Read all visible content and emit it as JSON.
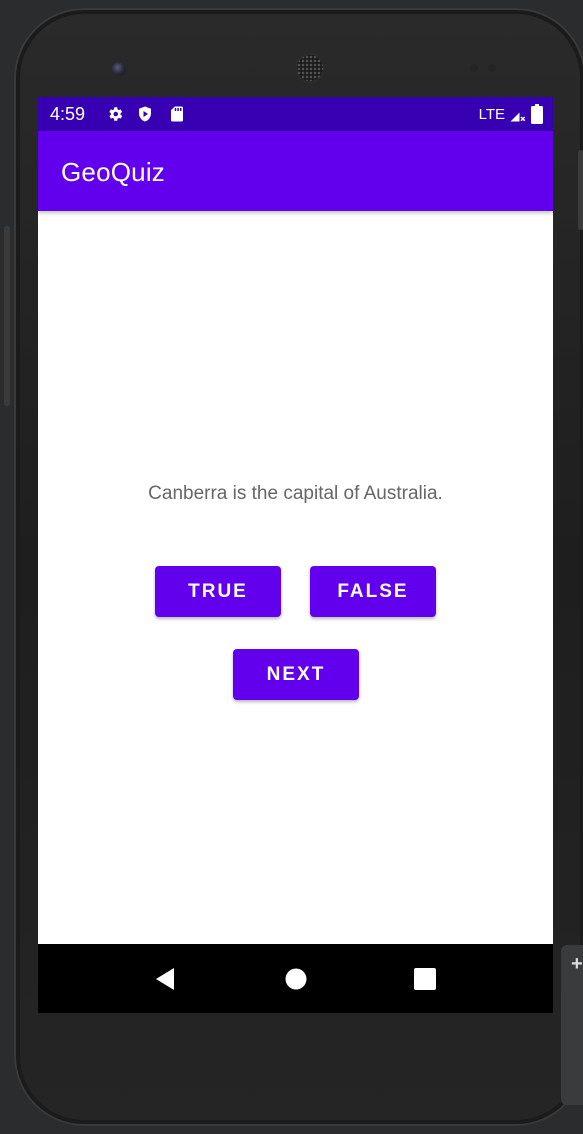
{
  "status_bar": {
    "time": "4:59",
    "network": "LTE",
    "icons": [
      "gear-icon",
      "shield-icon",
      "sd-card-icon",
      "signal-icon",
      "battery-icon"
    ],
    "background": "#3700b3"
  },
  "app_bar": {
    "title": "GeoQuiz",
    "background": "#6200ee"
  },
  "quiz": {
    "question": "Canberra is the capital of Australia.",
    "true_label": "TRUE",
    "false_label": "FALSE",
    "next_label": "NEXT"
  },
  "nav_bar": {
    "icons": [
      "back-icon",
      "home-icon",
      "recents-icon"
    ]
  },
  "colors": {
    "accent": "#6200ee",
    "status": "#3700b3",
    "question_text": "#666666"
  }
}
